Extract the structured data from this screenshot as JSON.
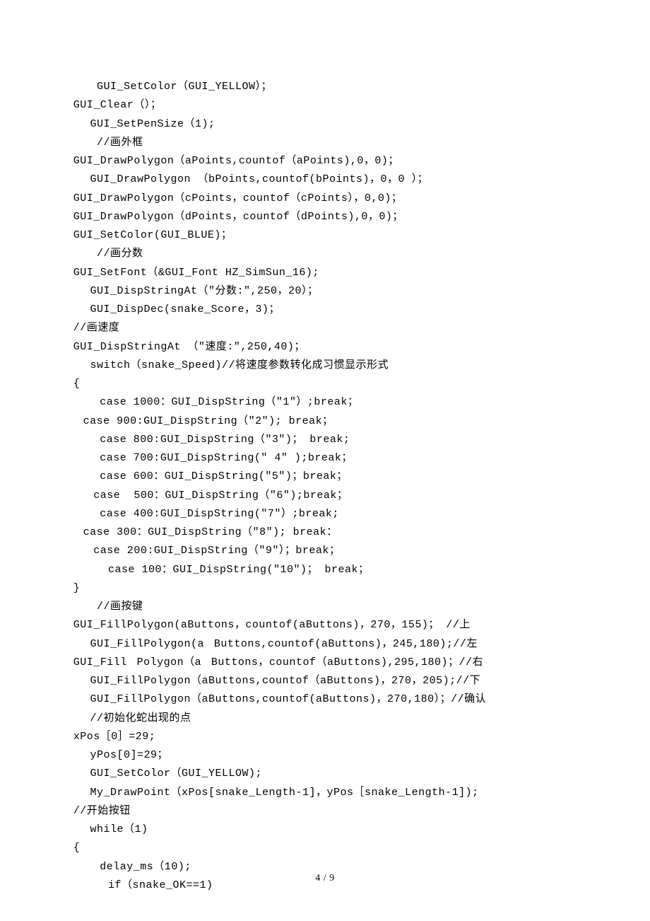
{
  "lines": [
    {
      "cls": "indent-1",
      "text": " GUI_SetColor（GUI_YELLOW）；"
    },
    {
      "cls": "",
      "text": "ﾠGUI_Clear（）；"
    },
    {
      "cls": "indent-1",
      "text": "GUI_SetPenSize（1);"
    },
    {
      "cls": "indent-1",
      "text": " //画外框"
    },
    {
      "cls": "",
      "text": "ﾠGUI_DrawPolygon（aPoints,countof（aPoints),0，0)；"
    },
    {
      "cls": "indent-1",
      "text": "GUI_DrawPolygon （bPoints,countof(bPoints)，0，0 ）；"
    },
    {
      "cls": "",
      "text": "ﾠGUI_DrawPolygon（cPoints，countof（cPoints），0,0)；"
    },
    {
      "cls": "",
      "text": "ﾠGUI_DrawPolygon（dPoints，countof（dPoints),0，0)；"
    },
    {
      "cls": "",
      "text": "ﾠGUI_SetColor(GUI_BLUE)；"
    },
    {
      "cls": "indent-1",
      "text": " //画分数"
    },
    {
      "cls": "",
      "text": "ﾠGUI_SetFont（&GUI_Font HZ_SimSun_16);"
    },
    {
      "cls": "indent-1",
      "text": "GUI_DispStringAt（\"分数:\",250，20）；"
    },
    {
      "cls": "indent-1",
      "text": "GUI_DispDec(snake_Score，3)；"
    },
    {
      "cls": "",
      "text": "ﾠ//画速度"
    },
    {
      "cls": "",
      "text": "ﾠGUI_DispStringAt （\"速度:\",250,40)；"
    },
    {
      "cls": "indent-1",
      "text": "switch（snake_Speed)//将速度参数转化成习惯显示形式"
    },
    {
      "cls": "",
      "text": "ﾠ{"
    },
    {
      "cls": "indent-1",
      "text": "ﾠcase 1000：GUI_DispString（\"1\"）;break；"
    },
    {
      "cls": "",
      "text": "ﾠﾠcase 900:GUI_DispString（\"2\"); break；"
    },
    {
      "cls": "indent-1",
      "text": "ﾠcase 800:GUI_DispString（\"3\")； break;"
    },
    {
      "cls": "indent-1",
      "text": "ﾠcase 700:GUI_DispString(\" 4\" );break；"
    },
    {
      "cls": "indent-1",
      "text": "ﾠcase 600：GUI_DispString(\"5\")；break；"
    },
    {
      "cls": "",
      "text": "ﾠ   case  500：GUI_DispString（\"6\");break；"
    },
    {
      "cls": "indent-1",
      "text": "ﾠcase 400:GUI_DispString(\"7\"）;break;"
    },
    {
      "cls": "",
      "text": "ﾠﾠcase 300：GUI_DispString（\"8\"); break："
    },
    {
      "cls": "",
      "text": "ﾠ   case 200:GUI_DispString（\"9\"）；break；"
    },
    {
      "cls": "indent-2",
      "text": "case 100：GUI_DispString(\"10\")； break；"
    },
    {
      "cls": "",
      "text": "ﾠ}"
    },
    {
      "cls": "indent-1",
      "text": " //画按键"
    },
    {
      "cls": "",
      "text": "ﾠGUI_FillPolygon(aButtons，countof(aButtons)，270，155)； //上"
    },
    {
      "cls": "indent-1",
      "text": "GUI_FillPolygon(aﾠButtons,countof(aButtons)，245,180);//左"
    },
    {
      "cls": "",
      "text": "ﾠGUI_FillﾠPolygon（aﾠButtons，countof（aButtons),295,180)；//右"
    },
    {
      "cls": "indent-1",
      "text": "GUI_FillPolygon（aButtons,countof（aButtons)，270，205);//下"
    },
    {
      "cls": "indent-1",
      "text": "GUI_FillPolygon（aButtons,countof(aButtons)，270,180）；//确认"
    },
    {
      "cls": "indent-1",
      "text": "//初始化蛇出现的点"
    },
    {
      "cls": "",
      "text": "ﾠxPos［0］=29;"
    },
    {
      "cls": "indent-1",
      "text": "yPos[0]=29；"
    },
    {
      "cls": "indent-1",
      "text": "GUI_SetColor（GUI_YELLOW);"
    },
    {
      "cls": "indent-1",
      "text": "My_DrawPoint（xPos[snake_Length-1]，yPos［snake_Length-1]);"
    },
    {
      "cls": "",
      "text": "ﾠ//开始按钮"
    },
    {
      "cls": "indent-1",
      "text": "while（1)"
    },
    {
      "cls": "",
      "text": "ﾠ{"
    },
    {
      "cls": "indent-1",
      "text": "ﾠdelay_ms（10);"
    },
    {
      "cls": "indent-2",
      "text": "if（snake_OK==1)"
    }
  ],
  "pagenum": "4 / 9"
}
